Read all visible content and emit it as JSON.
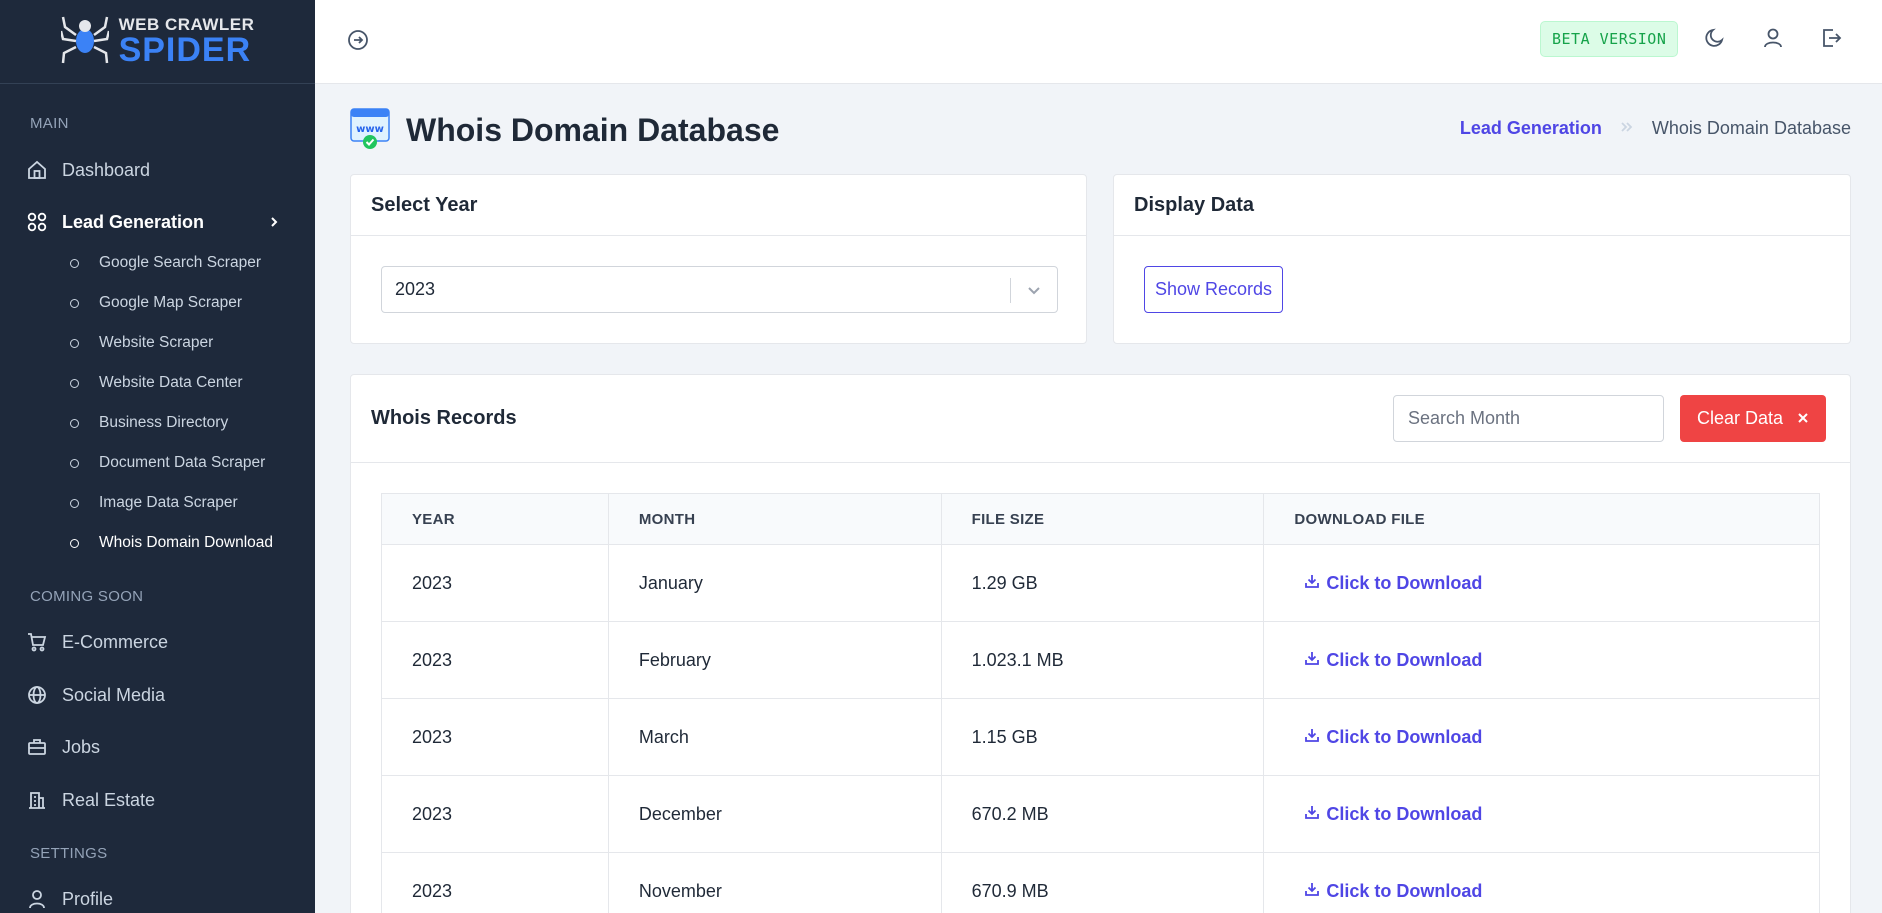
{
  "brand": {
    "top": "WEB CRAWLER",
    "bottom": "SPIDER"
  },
  "sidebar": {
    "main_label": "MAIN",
    "coming_label": "COMING SOON",
    "settings_label": "SETTINGS",
    "dashboard": "Dashboard",
    "lead_generation": "Lead Generation",
    "sub_items": [
      "Google Search Scraper",
      "Google Map Scraper",
      "Website Scraper",
      "Website Data Center",
      "Business Directory",
      "Document Data Scraper",
      "Image Data Scraper",
      "Whois Domain Download"
    ],
    "ecommerce": "E-Commerce",
    "social": "Social Media",
    "jobs": "Jobs",
    "real_estate": "Real Estate",
    "profile": "Profile"
  },
  "topbar": {
    "beta": "BETA VERSION"
  },
  "page": {
    "title": "Whois Domain Database",
    "breadcrumb_parent": "Lead Generation",
    "breadcrumb_current": "Whois Domain Database",
    "icon_text": "www"
  },
  "select_year": {
    "title": "Select Year",
    "value": "2023"
  },
  "display_data": {
    "title": "Display Data",
    "button": "Show Records"
  },
  "records": {
    "title": "Whois Records",
    "search_placeholder": "Search Month",
    "clear_button": "Clear Data",
    "columns": [
      "YEAR",
      "MONTH",
      "FILE SIZE",
      "DOWNLOAD FILE"
    ],
    "rows": [
      {
        "year": "2023",
        "month": "January",
        "size": "1.29 GB",
        "download": "Click to Download"
      },
      {
        "year": "2023",
        "month": "February",
        "size": "1.023.1 MB",
        "download": "Click to Download"
      },
      {
        "year": "2023",
        "month": "March",
        "size": "1.15 GB",
        "download": "Click to Download"
      },
      {
        "year": "2023",
        "month": "December",
        "size": "670.2 MB",
        "download": "Click to Download"
      },
      {
        "year": "2023",
        "month": "November",
        "size": "670.9 MB",
        "download": "Click to Download"
      }
    ]
  },
  "colors": {
    "sidebar_bg": "#1e293b",
    "accent": "#4f46e5",
    "danger": "#ef4444",
    "beta_bg": "#dcfce7",
    "beta_text": "#16a34a",
    "logo_blue": "#3b82f6"
  }
}
